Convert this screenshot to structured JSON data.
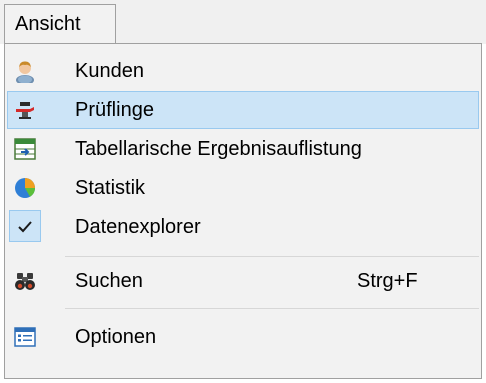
{
  "menu": {
    "title": "Ansicht",
    "items": [
      {
        "label": "Kunden",
        "icon": "user-icon"
      },
      {
        "label": "Prüflinge",
        "icon": "test-object-icon",
        "highlighted": true
      },
      {
        "label": "Tabellarische Ergebnisauflistung",
        "icon": "table-results-icon"
      },
      {
        "label": "Statistik",
        "icon": "pie-chart-icon"
      },
      {
        "label": "Datenexplorer",
        "icon": "checkmark-icon",
        "checked": true
      },
      {
        "label": "Suchen",
        "icon": "binoculars-icon",
        "shortcut": "Strg+F"
      },
      {
        "label": "Optionen",
        "icon": "options-icon"
      }
    ]
  },
  "colors": {
    "highlight_bg": "#cce4f7",
    "highlight_border": "#99c9ef",
    "menu_bg": "#f2f2f2"
  }
}
